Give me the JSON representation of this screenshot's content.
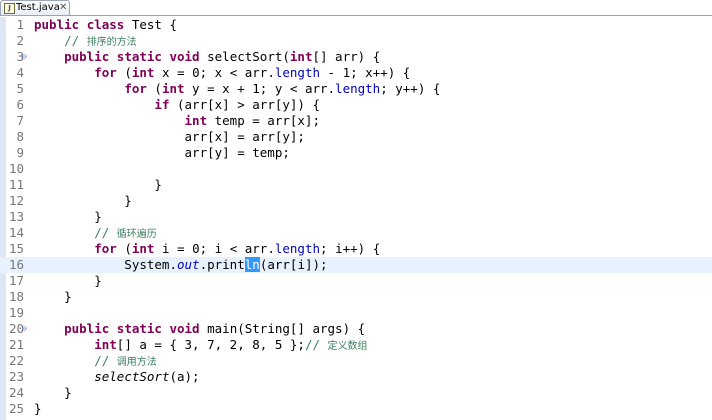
{
  "tab": {
    "icon": "java-file-icon",
    "label": "Test.java",
    "close": "✕"
  },
  "editor": {
    "current_line": 16,
    "lines": [
      {
        "n": "1",
        "fold": "",
        "tokens": [
          {
            "t": "public",
            "c": "kw"
          },
          {
            "t": " "
          },
          {
            "t": "class",
            "c": "kw"
          },
          {
            "t": " Test {"
          }
        ]
      },
      {
        "n": "2",
        "fold": "",
        "tokens": [
          {
            "t": "    // ",
            "c": "cm"
          },
          {
            "t": "排序的方法",
            "c": "cm cm-zh"
          }
        ]
      },
      {
        "n": "3",
        "fold": "⊖",
        "tokens": [
          {
            "t": "    "
          },
          {
            "t": "public",
            "c": "kw"
          },
          {
            "t": " "
          },
          {
            "t": "static",
            "c": "kw"
          },
          {
            "t": " "
          },
          {
            "t": "void",
            "c": "kw"
          },
          {
            "t": " selectSort("
          },
          {
            "t": "int",
            "c": "kw"
          },
          {
            "t": "[] arr) {"
          }
        ]
      },
      {
        "n": "4",
        "fold": "",
        "tokens": [
          {
            "t": "        "
          },
          {
            "t": "for",
            "c": "kw"
          },
          {
            "t": " ("
          },
          {
            "t": "int",
            "c": "kw"
          },
          {
            "t": " x = 0; x < arr."
          },
          {
            "t": "length",
            "c": "fld"
          },
          {
            "t": " - 1; x++) {"
          }
        ]
      },
      {
        "n": "5",
        "fold": "",
        "tokens": [
          {
            "t": "            "
          },
          {
            "t": "for",
            "c": "kw"
          },
          {
            "t": " ("
          },
          {
            "t": "int",
            "c": "kw"
          },
          {
            "t": " y = x + 1; y < arr."
          },
          {
            "t": "length",
            "c": "fld"
          },
          {
            "t": "; y++) {"
          }
        ]
      },
      {
        "n": "6",
        "fold": "",
        "tokens": [
          {
            "t": "                "
          },
          {
            "t": "if",
            "c": "kw"
          },
          {
            "t": " (arr[x] > arr[y]) {"
          }
        ]
      },
      {
        "n": "7",
        "fold": "",
        "tokens": [
          {
            "t": "                    "
          },
          {
            "t": "int",
            "c": "kw"
          },
          {
            "t": " temp = arr[x];"
          }
        ]
      },
      {
        "n": "8",
        "fold": "",
        "tokens": [
          {
            "t": "                    arr[x] = arr[y];"
          }
        ]
      },
      {
        "n": "9",
        "fold": "",
        "tokens": [
          {
            "t": "                    arr[y] = temp;"
          }
        ]
      },
      {
        "n": "10",
        "fold": "",
        "tokens": []
      },
      {
        "n": "11",
        "fold": "",
        "tokens": [
          {
            "t": "                }"
          }
        ]
      },
      {
        "n": "12",
        "fold": "",
        "tokens": [
          {
            "t": "            }"
          }
        ]
      },
      {
        "n": "13",
        "fold": "",
        "tokens": [
          {
            "t": "        }"
          }
        ]
      },
      {
        "n": "14",
        "fold": "",
        "tokens": [
          {
            "t": "        // ",
            "c": "cm"
          },
          {
            "t": "循环遍历",
            "c": "cm cm-zh"
          }
        ]
      },
      {
        "n": "15",
        "fold": "",
        "tokens": [
          {
            "t": "        "
          },
          {
            "t": "for",
            "c": "kw"
          },
          {
            "t": " ("
          },
          {
            "t": "int",
            "c": "kw"
          },
          {
            "t": " i = 0; i < arr."
          },
          {
            "t": "length",
            "c": "fld"
          },
          {
            "t": "; i++) {"
          }
        ]
      },
      {
        "n": "16",
        "fold": "",
        "tokens": [
          {
            "t": "            System."
          },
          {
            "t": "out",
            "c": "fld it"
          },
          {
            "t": "."
          },
          {
            "t": "print"
          },
          {
            "t": "ln",
            "c": "sel"
          },
          {
            "t": "(arr[i]);"
          }
        ]
      },
      {
        "n": "17",
        "fold": "",
        "tokens": [
          {
            "t": "        }"
          }
        ]
      },
      {
        "n": "18",
        "fold": "",
        "tokens": [
          {
            "t": "    }"
          }
        ]
      },
      {
        "n": "19",
        "fold": "",
        "tokens": []
      },
      {
        "n": "20",
        "fold": "⊖",
        "tokens": [
          {
            "t": "    "
          },
          {
            "t": "public",
            "c": "kw"
          },
          {
            "t": " "
          },
          {
            "t": "static",
            "c": "kw"
          },
          {
            "t": " "
          },
          {
            "t": "void",
            "c": "kw"
          },
          {
            "t": " main(String[] args) {"
          }
        ]
      },
      {
        "n": "21",
        "fold": "",
        "tokens": [
          {
            "t": "        "
          },
          {
            "t": "int",
            "c": "kw"
          },
          {
            "t": "[] a = { 3, 7, 2, 8, 5 };"
          },
          {
            "t": "// ",
            "c": "cm"
          },
          {
            "t": "定义数组",
            "c": "cm cm-zh"
          }
        ]
      },
      {
        "n": "22",
        "fold": "",
        "tokens": [
          {
            "t": "        // ",
            "c": "cm"
          },
          {
            "t": "调用方法",
            "c": "cm cm-zh"
          }
        ]
      },
      {
        "n": "23",
        "fold": "",
        "tokens": [
          {
            "t": "        "
          },
          {
            "t": "selectSort",
            "c": "it"
          },
          {
            "t": "(a);"
          }
        ]
      },
      {
        "n": "24",
        "fold": "",
        "tokens": [
          {
            "t": "    }"
          }
        ]
      },
      {
        "n": "25",
        "fold": "",
        "tokens": [
          {
            "t": "}"
          }
        ]
      }
    ]
  }
}
